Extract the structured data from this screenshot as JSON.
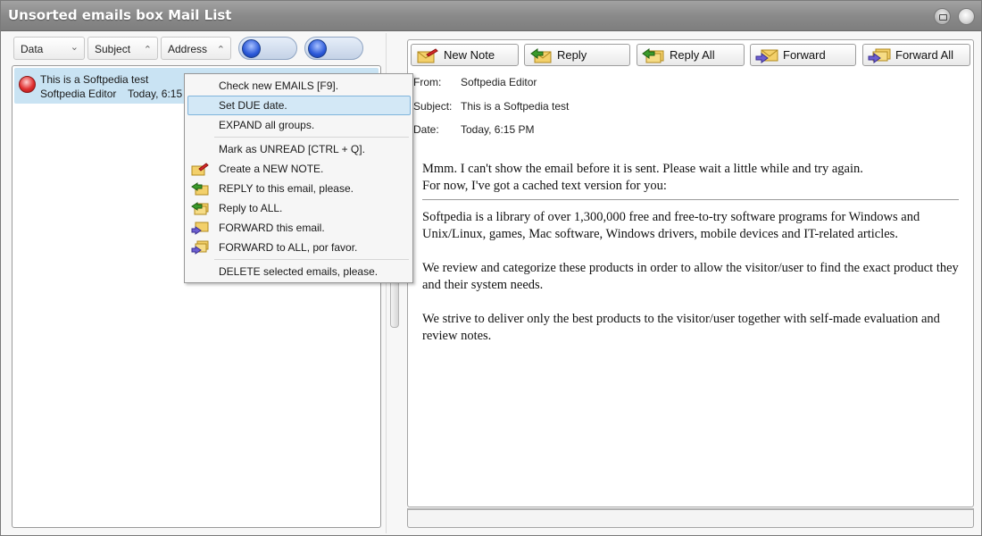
{
  "window": {
    "title": "Unsorted emails box Mail List"
  },
  "sort_bar": {
    "buttons": [
      {
        "label": "Data",
        "arrow": "chevron-down"
      },
      {
        "label": "Subject",
        "arrow": "chevron-up"
      },
      {
        "label": "Address",
        "arrow": "chevron-up"
      }
    ]
  },
  "mail_list": {
    "items": [
      {
        "subject": "This is a Softpedia test",
        "from": "Softpedia Editor",
        "date": "Today, 6:15",
        "status_color": "#e03030"
      }
    ]
  },
  "context_menu": {
    "items": [
      {
        "label": "Check new EMAILS [F9].",
        "icon": ""
      },
      {
        "label": "Set DUE date.",
        "icon": "",
        "selected": true
      },
      {
        "label": "EXPAND all groups.",
        "icon": ""
      },
      {
        "label": "Mark as UNREAD [CTRL + Q].",
        "icon": ""
      },
      {
        "label": "Create a NEW NOTE.",
        "icon": "new-note-icon"
      },
      {
        "label": "REPLY to this email, please.",
        "icon": "reply-icon"
      },
      {
        "label": "Reply to ALL.",
        "icon": "reply-all-icon"
      },
      {
        "label": "FORWARD this email.",
        "icon": "forward-icon"
      },
      {
        "label": "FORWARD to ALL, por favor.",
        "icon": "forward-all-icon"
      },
      {
        "label": "DELETE selected emails, please.",
        "icon": ""
      }
    ]
  },
  "toolbar": {
    "new_note": "New Note",
    "reply": "Reply",
    "reply_all": "Reply All",
    "forward": "Forward",
    "forward_all": "Forward All"
  },
  "message": {
    "from_label": "From:",
    "from_value": "Softpedia Editor",
    "subject_label": "Subject:",
    "subject_value": "This is a Softpedia test",
    "date_label": "Date:",
    "date_value": "Today, 6:15 PM",
    "notice_line1": "Mmm. I can't show the email before it is sent. Please wait a little while and try again.",
    "notice_line2": "For now, I've got a cached text version for you:",
    "paragraphs": [
      "Softpedia is a library of over 1,300,000 free and free-to-try software programs for Windows and Unix/Linux, games, Mac software, Windows drivers, mobile devices and IT-related articles.",
      "We review and categorize these products in order to allow the visitor/user to find the exact product they and their system needs.",
      "We strive to deliver only the best products to the visitor/user together with self-made evaluation and review notes."
    ]
  },
  "colors": {
    "selection": "#c9e3f3",
    "menu_highlight": "#d3e8f6",
    "accent_blue": "#2a58d8"
  }
}
